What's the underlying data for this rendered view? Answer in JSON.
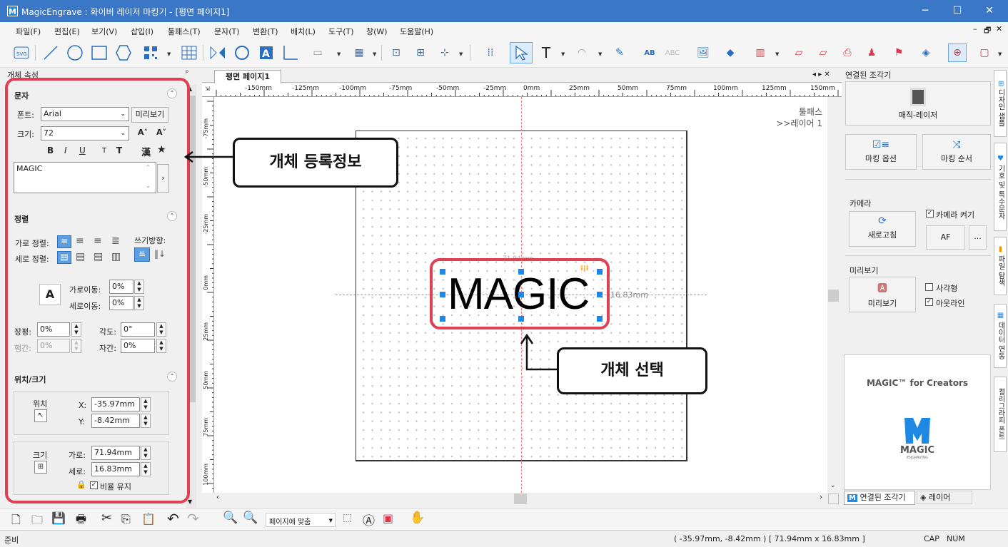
{
  "window": {
    "title": "MagicEngrave : 화이버 레이저 마킹기 - [평면  페이지1]",
    "min": "─",
    "max": "☐",
    "close": "✕"
  },
  "menu": [
    "파일(F)",
    "편집(E)",
    "보기(V)",
    "삽입(I)",
    "툴패스(T)",
    "문자(T)",
    "변환(T)",
    "배치(L)",
    "도구(T)",
    "창(W)",
    "도움말(H)"
  ],
  "mdi": {
    "min": "–",
    "restore": "🗗",
    "close": "✕"
  },
  "left_panel": {
    "title": "개체 속성",
    "pin": "ᵖ",
    "text_section": {
      "title": "문자",
      "font_label": "폰트:",
      "font_value": "Arial",
      "preview_btn": "미리보기",
      "size_label": "크기:",
      "size_value": "72",
      "text_value": "MAGIC",
      "style_buttons": [
        "B",
        "I",
        "U",
        "T",
        "T",
        "漢",
        "★"
      ]
    },
    "align_section": {
      "title": "정렬",
      "h_align_label": "가로 정렬:",
      "v_align_label": "세로 정렬:",
      "write_dir_label": "쓰기방향:",
      "h_move_label": "가로이동:",
      "h_move_value": "0%",
      "v_move_label": "세로이동:",
      "v_move_value": "0%",
      "stretch_label": "장평:",
      "stretch_value": "0%",
      "angle_label": "각도:",
      "angle_value": "0°",
      "line_gap_label": "행간:",
      "line_gap_value": "0%",
      "char_gap_label": "자간:",
      "char_gap_value": "0%"
    },
    "pos_section": {
      "title": "위치/크기",
      "pos_label": "위치",
      "x_label": "X:",
      "x_value": "-35.97mm",
      "y_label": "Y:",
      "y_value": "-8.42mm",
      "size_label": "크기",
      "w_label": "가로:",
      "w_value": "71.94mm",
      "h_label": "세로:",
      "h_value": "16.83mm",
      "ratio_label": "비율 유지"
    }
  },
  "doc": {
    "tab": "평면  페이지1",
    "nav": "◂ ▸ ✕",
    "ruler_top": [
      "-150mm",
      "-125mm",
      "-100mm",
      "-75mm",
      "-50mm",
      "-25mm",
      "0mm",
      "25mm",
      "50mm",
      "75mm",
      "100mm",
      "125mm",
      "150mm"
    ],
    "ruler_left": [
      "-75mm",
      "-50mm",
      "-25mm",
      "0mm",
      "25mm",
      "50mm",
      "75mm",
      "100mm"
    ],
    "toolpath_label": "툴패스",
    "layer_label": ">>레이어 1",
    "object_text": "MAGIC",
    "width_label": "71.94mm",
    "height_label": "16.83mm"
  },
  "callouts": {
    "left": "개체 등록정보",
    "right": "개체 선택"
  },
  "right_panel": {
    "title": "연결된 조각기",
    "device": "매직-레이저",
    "marking_option": "마킹 옵션",
    "marking_order": "마킹 순서",
    "camera_title": "카메라",
    "camera_on": "카메라 켜기",
    "refresh": "새로고침",
    "af": "AF",
    "more": "...",
    "preview_title": "미리보기",
    "preview_btn": "미리보기",
    "rect_opt": "사각형",
    "outline_opt": "아웃라인",
    "promo_title": "MAGIC™ for Creators",
    "promo_logo": "MAGIC",
    "promo_sub": "ENGRAVING",
    "bottom_tabs": [
      "연결된 조각기",
      "레이어"
    ]
  },
  "side_tabs": [
    "디자인 샘플",
    "기호 및 특수문자",
    "파일 탐색",
    "데이터 연동",
    "컬리그라피 폰트"
  ],
  "bottom_toolbar": {
    "zoom_fit": "페이지에 맞춤"
  },
  "status": {
    "left": "준비",
    "coords": "( -35.97mm, -8.42mm )  [ 71.94mm x 16.83mm ]",
    "cap": "CAP",
    "num": "NUM"
  },
  "colors": {
    "titlebar": "#3a77c6",
    "highlight": "#e04152",
    "accent": "#1e88e5"
  }
}
